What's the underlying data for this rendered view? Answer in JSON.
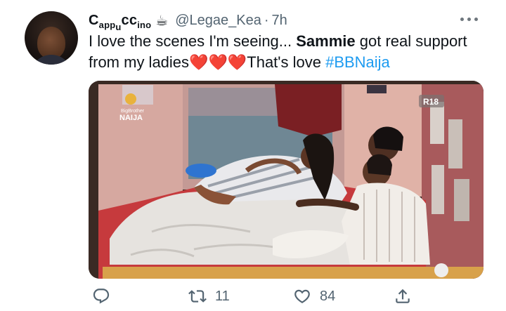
{
  "tweet": {
    "display_name_parts": [
      "C",
      "app",
      "u",
      "cc",
      "ino"
    ],
    "display_name_emoji": "☕",
    "handle": "@Legae_Kea",
    "separator": "·",
    "time": "7h",
    "text_part1": "I love the scenes I'm seeing... ",
    "text_bold": "Sammie",
    "text_part2": " got real support from my ladies",
    "hearts": [
      "❤️",
      "❤️",
      "❤️"
    ],
    "text_part3": "That's love ",
    "hashtag": "#BBNaija"
  },
  "media": {
    "logo_line1": "BigBrother",
    "logo_line2": "NAIJA",
    "rating": "R18"
  },
  "actions": {
    "reply_icon": "reply-icon",
    "retweet_icon": "retweet-icon",
    "retweet_count": "11",
    "like_icon": "heart-outline-icon",
    "like_count": "84",
    "share_icon": "share-icon"
  },
  "colors": {
    "link": "#1d9bf0",
    "secondary_text": "#536471",
    "heart": "#e0245e"
  }
}
